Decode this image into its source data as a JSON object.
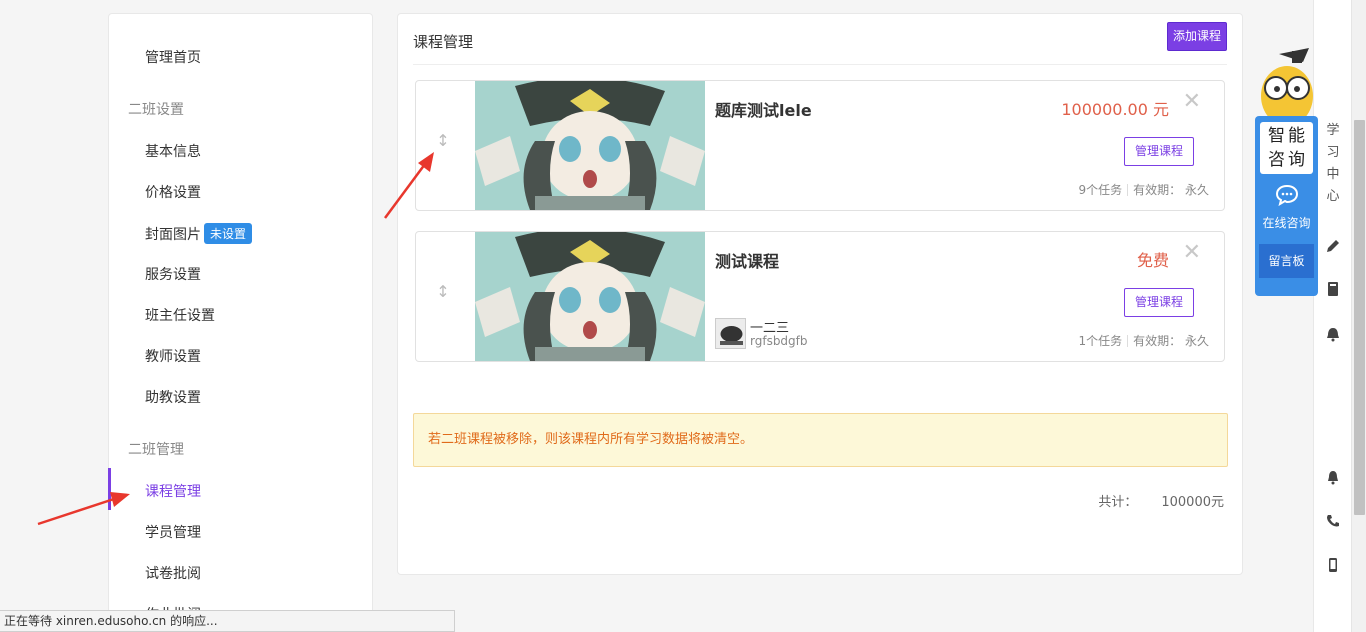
{
  "sidebar": {
    "home": "管理首页",
    "group_settings": "二班设置",
    "basic_info": "基本信息",
    "price_settings": "价格设置",
    "cover_image": "封面图片",
    "cover_badge": "未设置",
    "service_settings": "服务设置",
    "head_teacher": "班主任设置",
    "teacher_settings": "教师设置",
    "assistant_settings": "助教设置",
    "group_manage": "二班管理",
    "course_manage": "课程管理",
    "student_manage": "学员管理",
    "exam_review": "试卷批阅",
    "homework_review": "作业批阅"
  },
  "main": {
    "title": "课程管理",
    "add_button": "添加课程",
    "courses": [
      {
        "name": "题库测试lele",
        "price": "100000.00 元",
        "manage_label": "管理课程",
        "tasks": "9个任务",
        "validity": "有效期：  永久"
      },
      {
        "name": "测试课程",
        "price": "免费",
        "manage_label": "管理课程",
        "teacher_name": "一二三",
        "teacher_title": "rgfsbdgfb",
        "tasks": "1个任务",
        "validity": "有效期：  永久"
      }
    ],
    "notice": "若二班课程被移除，则该课程内所有学习数据将被清空。",
    "total_label": "共计：",
    "total_amount": "100000元"
  },
  "consult": {
    "card_line1": "智能",
    "card_line2": "咨询",
    "online": "在线咨询",
    "message_board": "留言板"
  },
  "right_bar": {
    "study_center": "学习中心"
  },
  "status_bar": "正在等待 xinren.edusoho.cn 的响应...",
  "colors": {
    "accent": "#7b3fe4",
    "price": "#e0604a",
    "badge": "#2f8de6",
    "consult": "#3a8ee6"
  }
}
